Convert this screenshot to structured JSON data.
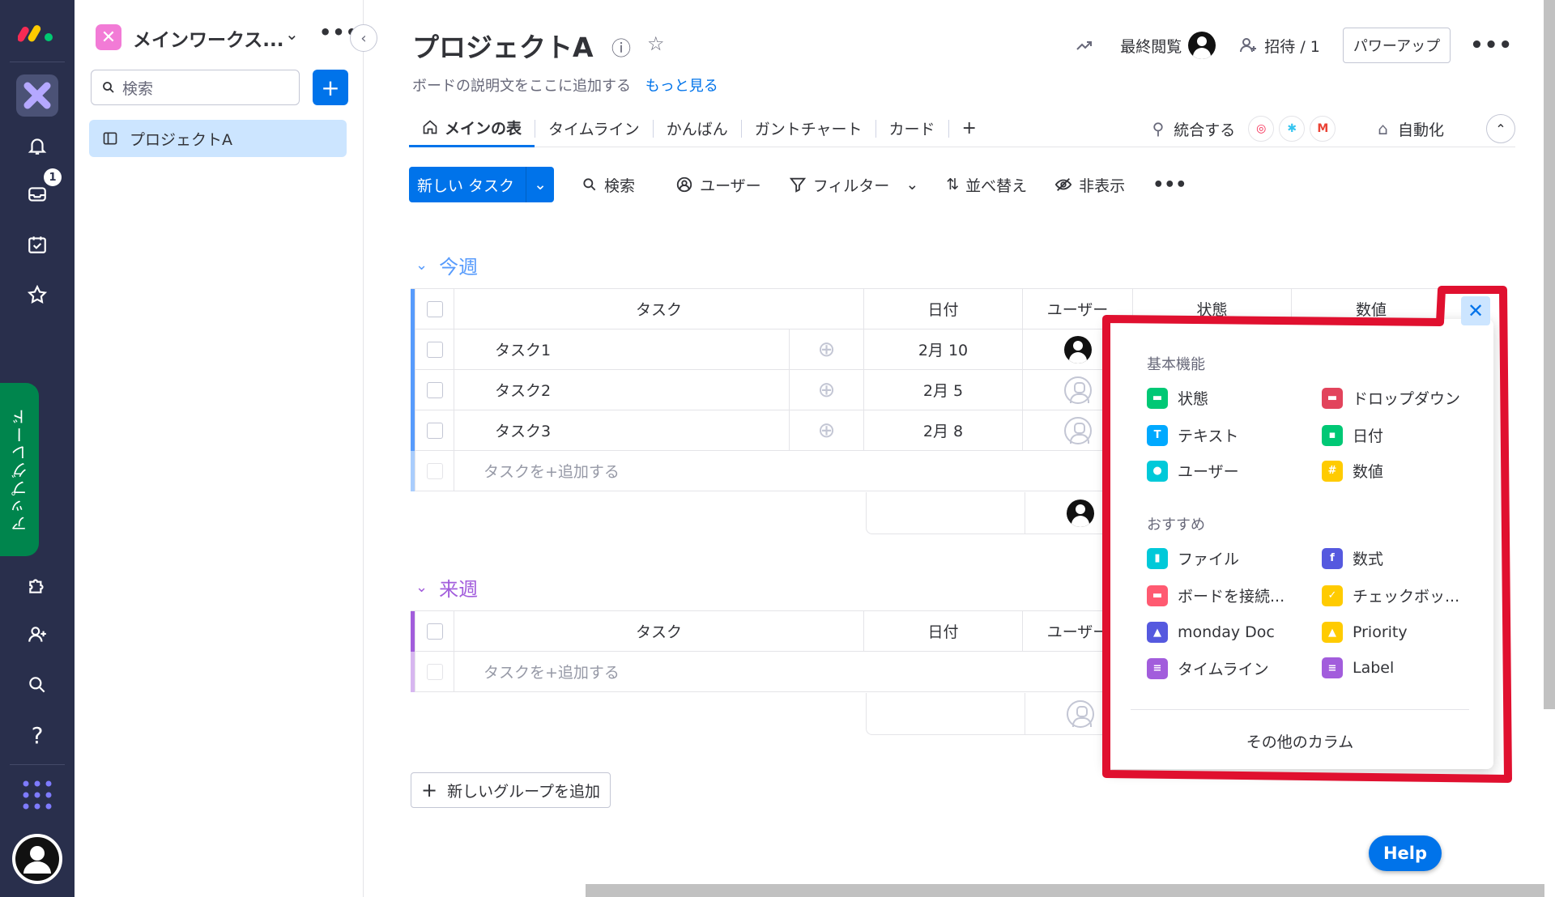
{
  "sidebar": {
    "workspace_name": "メインワークス...",
    "search_placeholder": "検索",
    "board_item": "プロジェクトA",
    "upgrade_label": "アップグレード",
    "inbox_badge": "1"
  },
  "header": {
    "title": "プロジェクトA",
    "description": "ボードの説明文をここに追加する",
    "see_more": "もっと見る",
    "last_viewed": "最終閲覧",
    "invite": "招待 / 1",
    "power_up": "パワーアップ"
  },
  "tabs": [
    "メインの表",
    "タイムライン",
    "かんばん",
    "ガントチャート",
    "カード"
  ],
  "tabs_right": {
    "integrate": "統合する",
    "automate": "自動化"
  },
  "toolbar": {
    "new_task": "新しい タスク",
    "search": "検索",
    "user": "ユーザー",
    "filter": "フィルター",
    "sort": "並べ替え",
    "hide": "非表示"
  },
  "groups": [
    {
      "title": "今週",
      "columns": {
        "task": "タスク",
        "date": "日付",
        "user": "ユーザー",
        "status": "状態",
        "number": "数値"
      },
      "rows": [
        {
          "task": "タスク1",
          "date": "2月 10",
          "user": "filled"
        },
        {
          "task": "タスク2",
          "date": "2月 5",
          "user": "empty"
        },
        {
          "task": "タスク3",
          "date": "2月 8",
          "user": "empty"
        }
      ],
      "add_row": "タスクを+追加する"
    },
    {
      "title": "来週",
      "columns": {
        "task": "タスク",
        "date": "日付",
        "user": "ユーザー"
      },
      "rows": [],
      "add_row": "タスクを+追加する"
    }
  ],
  "add_group": "新しいグループを追加",
  "column_menu": {
    "basic_title": "基本機能",
    "basic": [
      {
        "label": "状態",
        "icon": "status-icon",
        "color": "#00c875"
      },
      {
        "label": "ドロップダウン",
        "icon": "dropdown-icon",
        "color": "#e2445c"
      },
      {
        "label": "テキスト",
        "icon": "text-icon",
        "color": "#00a9ff"
      },
      {
        "label": "日付",
        "icon": "date-icon",
        "color": "#00c875"
      },
      {
        "label": "ユーザー",
        "icon": "people-icon",
        "color": "#00c9d9"
      },
      {
        "label": "数値",
        "icon": "numbers-icon",
        "color": "#ffcb00"
      }
    ],
    "recommended_title": "おすすめ",
    "recommended": [
      {
        "label": "ファイル",
        "icon": "file-icon",
        "color": "#00c9d9"
      },
      {
        "label": "数式",
        "icon": "formula-icon",
        "color": "#5559df"
      },
      {
        "label": "ボードを接続...",
        "icon": "connect-boards-icon",
        "color": "#ff5a71"
      },
      {
        "label": "チェックボッ...",
        "icon": "checkbox-icon",
        "color": "#ffcb00"
      },
      {
        "label": "monday Doc",
        "icon": "doc-icon",
        "color": "#5559df"
      },
      {
        "label": "Priority",
        "icon": "priority-icon",
        "color": "#ffcb00"
      },
      {
        "label": "タイムライン",
        "icon": "timeline-icon",
        "color": "#a25ddc"
      },
      {
        "label": "Label",
        "icon": "label-icon",
        "color": "#a25ddc"
      }
    ],
    "more": "その他のカラム"
  },
  "help": "Help"
}
